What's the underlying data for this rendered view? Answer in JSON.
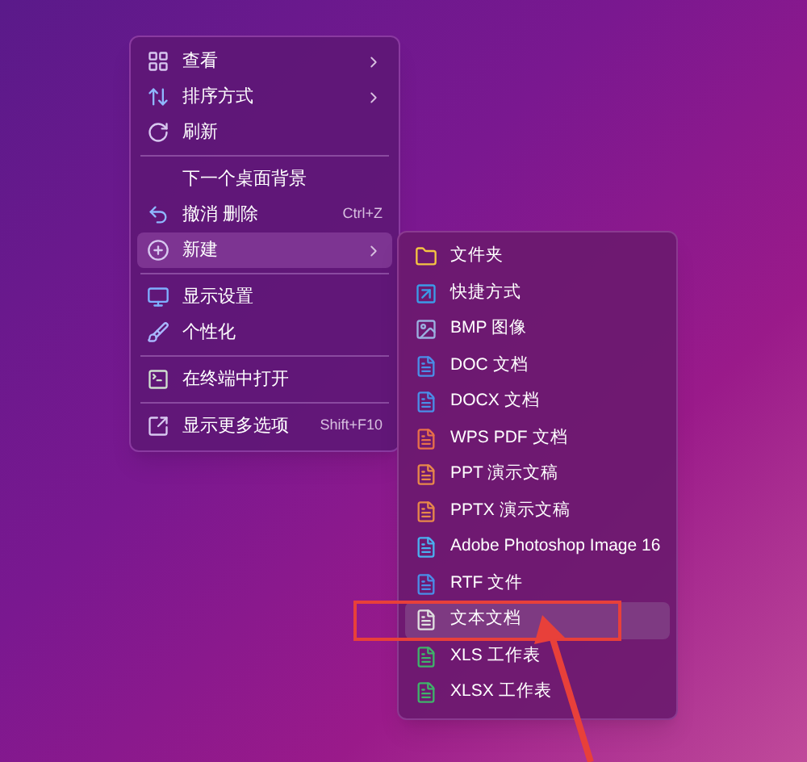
{
  "context_menu": {
    "items": [
      {
        "kind": "item",
        "label": "查看",
        "submenu": true,
        "selected": false
      },
      {
        "kind": "item",
        "label": "排序方式",
        "submenu": true,
        "selected": false
      },
      {
        "kind": "item",
        "label": "刷新",
        "submenu": false,
        "selected": false
      },
      {
        "kind": "separator"
      },
      {
        "kind": "item",
        "label": "下一个桌面背景",
        "submenu": false,
        "selected": false
      },
      {
        "kind": "item",
        "label": "撤消 删除",
        "shortcut": "Ctrl+Z",
        "submenu": false,
        "selected": false
      },
      {
        "kind": "item",
        "label": "新建",
        "submenu": true,
        "selected": true
      },
      {
        "kind": "separator"
      },
      {
        "kind": "item",
        "label": "显示设置",
        "submenu": false,
        "selected": false
      },
      {
        "kind": "item",
        "label": "个性化",
        "submenu": false,
        "selected": false
      },
      {
        "kind": "separator"
      },
      {
        "kind": "item",
        "label": "在终端中打开",
        "submenu": false,
        "selected": false
      },
      {
        "kind": "separator"
      },
      {
        "kind": "item",
        "label": "显示更多选项",
        "shortcut": "Shift+F10",
        "submenu": false,
        "selected": false
      }
    ]
  },
  "new_submenu": {
    "items": [
      {
        "label": "文件夹",
        "selected": false,
        "marked": false
      },
      {
        "label": "快捷方式",
        "selected": false,
        "marked": false
      },
      {
        "label": "BMP 图像",
        "selected": false,
        "marked": false
      },
      {
        "label": "DOC 文档",
        "selected": false,
        "marked": false
      },
      {
        "label": "DOCX 文档",
        "selected": false,
        "marked": false
      },
      {
        "label": "WPS PDF 文档",
        "selected": false,
        "marked": false
      },
      {
        "label": "PPT 演示文稿",
        "selected": false,
        "marked": false
      },
      {
        "label": "PPTX 演示文稿",
        "selected": false,
        "marked": false
      },
      {
        "label": "Adobe Photoshop Image 16",
        "selected": false,
        "marked": false
      },
      {
        "label": "RTF 文件",
        "selected": false,
        "marked": false
      },
      {
        "label": "文本文档",
        "selected": true,
        "marked": true
      },
      {
        "label": "XLS 工作表",
        "selected": false,
        "marked": false
      },
      {
        "label": "XLSX 工作表",
        "selected": false,
        "marked": false
      }
    ]
  }
}
